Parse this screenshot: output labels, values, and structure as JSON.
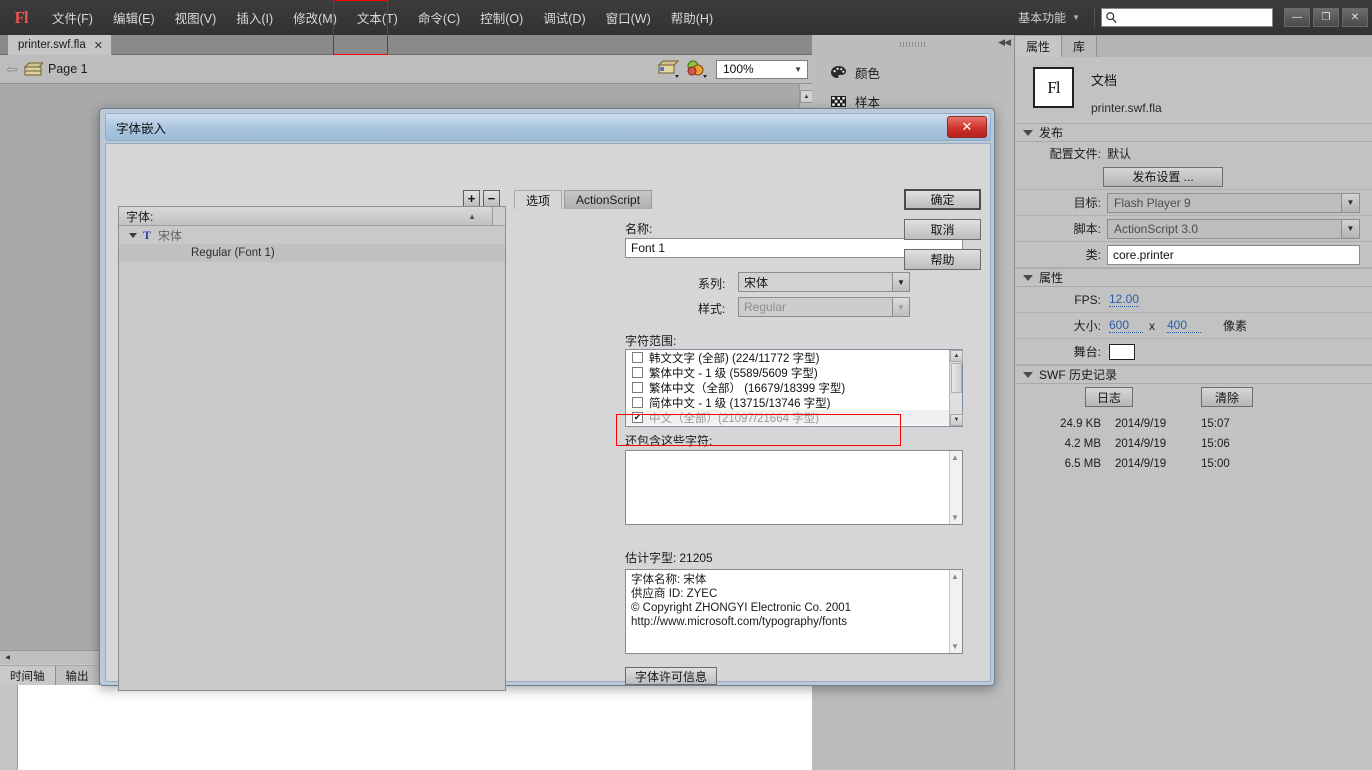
{
  "menubar": {
    "logo": "Fl",
    "items": [
      {
        "label": "文件(F)",
        "name": "menu-file"
      },
      {
        "label": "编辑(E)",
        "name": "menu-edit"
      },
      {
        "label": "视图(V)",
        "name": "menu-view"
      },
      {
        "label": "插入(I)",
        "name": "menu-insert"
      },
      {
        "label": "修改(M)",
        "name": "menu-modify"
      },
      {
        "label": "文本(T)",
        "name": "menu-text"
      },
      {
        "label": "命令(C)",
        "name": "menu-commands"
      },
      {
        "label": "控制(O)",
        "name": "menu-control"
      },
      {
        "label": "调试(D)",
        "name": "menu-debug"
      },
      {
        "label": "窗口(W)",
        "name": "menu-window"
      },
      {
        "label": "帮助(H)",
        "name": "menu-help"
      }
    ],
    "workspace": "基本功能",
    "search_placeholder": "",
    "search_value": "",
    "win_minimize": "—",
    "win_maximize": "❐",
    "win_close": "✕"
  },
  "doctab": {
    "title": "printer.swf.fla",
    "close": "✕"
  },
  "editbar": {
    "scene": "Page 1",
    "zoom": "100%"
  },
  "mid_dock": {
    "items": [
      {
        "label": "颜色",
        "icon": "color-palette-icon"
      },
      {
        "label": "样本",
        "icon": "swatches-grid-icon"
      }
    ]
  },
  "bottom": {
    "tabs": [
      {
        "label": "时间轴",
        "active": true
      },
      {
        "label": "输出",
        "active": false
      }
    ]
  },
  "rightpanel": {
    "tabs": [
      {
        "label": "属性",
        "active": true
      },
      {
        "label": "库",
        "active": false
      }
    ],
    "doc_icon_text": "Fl",
    "doc_title": "文档",
    "doc_file": "printer.swf.fla",
    "publish_section": "发布",
    "profile_label": "配置文件:",
    "profile_value": "默认",
    "publish_settings_btn": "发布设置 ...",
    "target_label": "目标:",
    "target_value": "Flash Player 9",
    "script_label": "脚本:",
    "script_value": "ActionScript 3.0",
    "class_label": "类:",
    "class_value": "core.printer",
    "properties_section": "属性",
    "fps_label": "FPS:",
    "fps_value": "12.00",
    "size_label": "大小:",
    "size_w": "600",
    "size_x": "x",
    "size_h": "400",
    "size_unit": "像素",
    "stage_label": "舞台:",
    "stage_color": "#ffffff",
    "swf_history_section": "SWF 历史记录",
    "log_btn": "日志",
    "clear_btn": "清除",
    "history": [
      {
        "size": "24.9 KB",
        "date": "2014/9/19",
        "time": "15:07"
      },
      {
        "size": "4.2 MB",
        "date": "2014/9/19",
        "time": "15:06"
      },
      {
        "size": "6.5 MB",
        "date": "2014/9/19",
        "time": "15:00"
      }
    ]
  },
  "dialog": {
    "title": "字体嵌入",
    "close": "✕",
    "add_btn": "+",
    "remove_btn": "−",
    "fontlist_header": "字体:",
    "font_root": "宋体",
    "font_child": "Regular (Font 1)",
    "tabs": [
      {
        "label": "选项",
        "active": true
      },
      {
        "label": "ActionScript",
        "active": false
      }
    ],
    "name_label": "名称:",
    "name_value": "Font 1",
    "family_label": "系列:",
    "family_value": "宋体",
    "style_label": "样式:",
    "style_value": "Regular",
    "charrange_label": "字符范围:",
    "ranges": [
      {
        "label": "韩文文字 (全部) (224/11772 字型)",
        "checked": false,
        "dim": false
      },
      {
        "label": "繁体中文 - 1 级 (5589/5609 字型)",
        "checked": false,
        "dim": false
      },
      {
        "label": "繁体中文（全部） (16679/18399 字型)",
        "checked": false,
        "dim": false
      },
      {
        "label": "简体中文 - 1 级 (13715/13746 字型)",
        "checked": false,
        "dim": false
      },
      {
        "label": "中文（全部）(21097/21664 字型)",
        "checked": true,
        "dim": true
      }
    ],
    "also_include_label": "还包含这些字符:",
    "also_include_value": "",
    "estimate_label": "估计字型:",
    "estimate_value": "21205",
    "font_info": [
      "字体名称: 宋体",
      "供应商 ID: ZYEC",
      "© Copyright ZHONGYI Electronic Co. 2001",
      "http://www.microsoft.com/typography/fonts"
    ],
    "license_btn": "字体许可信息",
    "ok_btn": "确定",
    "cancel_btn": "取消",
    "help_btn": "帮助"
  }
}
